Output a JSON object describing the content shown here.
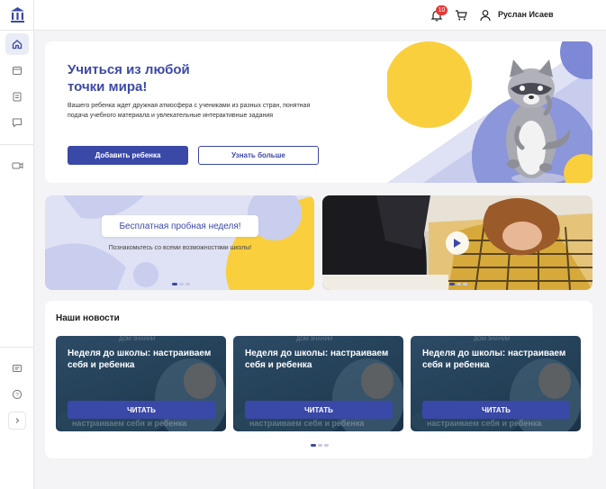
{
  "topbar": {
    "notifications_count": "10",
    "user_name": "Руслан Исаев"
  },
  "sidebar": {
    "items": [
      {
        "icon": "home-icon",
        "active": true
      },
      {
        "icon": "calendar-icon",
        "active": false
      },
      {
        "icon": "clipboard-icon",
        "active": false
      },
      {
        "icon": "chat-icon",
        "active": false
      },
      {
        "icon": "video-icon",
        "active": false
      }
    ],
    "bottom_items": [
      {
        "icon": "id-card-icon"
      },
      {
        "icon": "help-icon"
      },
      {
        "icon": "expand-chevron-icon"
      }
    ]
  },
  "hero": {
    "title_line1": "Учиться из любой",
    "title_line2": "точки мира!",
    "text": "Вашего ребенка ждет дружная атмосфера с учениками из разных стран, понятная подача учебного материала и увлекательные интерактивные задания",
    "primary_button": "Добавить ребенка",
    "secondary_button": "Узнать больше"
  },
  "promo": {
    "title": "Бесплатная пробная неделя!",
    "subtitle": "Познакомьтесь со всеми возможностями школы!"
  },
  "news": {
    "heading": "Наши новости",
    "cards": [
      {
        "title": "Неделя до школы: настраиваем себя и ребенка",
        "button": "ЧИТАТЬ",
        "ghost_text": "настраиваем себя и ребенка"
      },
      {
        "title": "Неделя до школы: настраиваем себя и ребенка",
        "button": "ЧИТАТЬ",
        "ghost_text": "настраиваем себя и ребенка"
      },
      {
        "title": "Неделя до школы: настраиваем себя и ребенка",
        "button": "ЧИТАТЬ",
        "ghost_text": "настраиваем себя и ребенка"
      }
    ]
  },
  "colors": {
    "accent": "#3a48a8",
    "accent_light": "#dfe1f4",
    "yellow": "#f9cf3d",
    "badge": "#e53935"
  }
}
